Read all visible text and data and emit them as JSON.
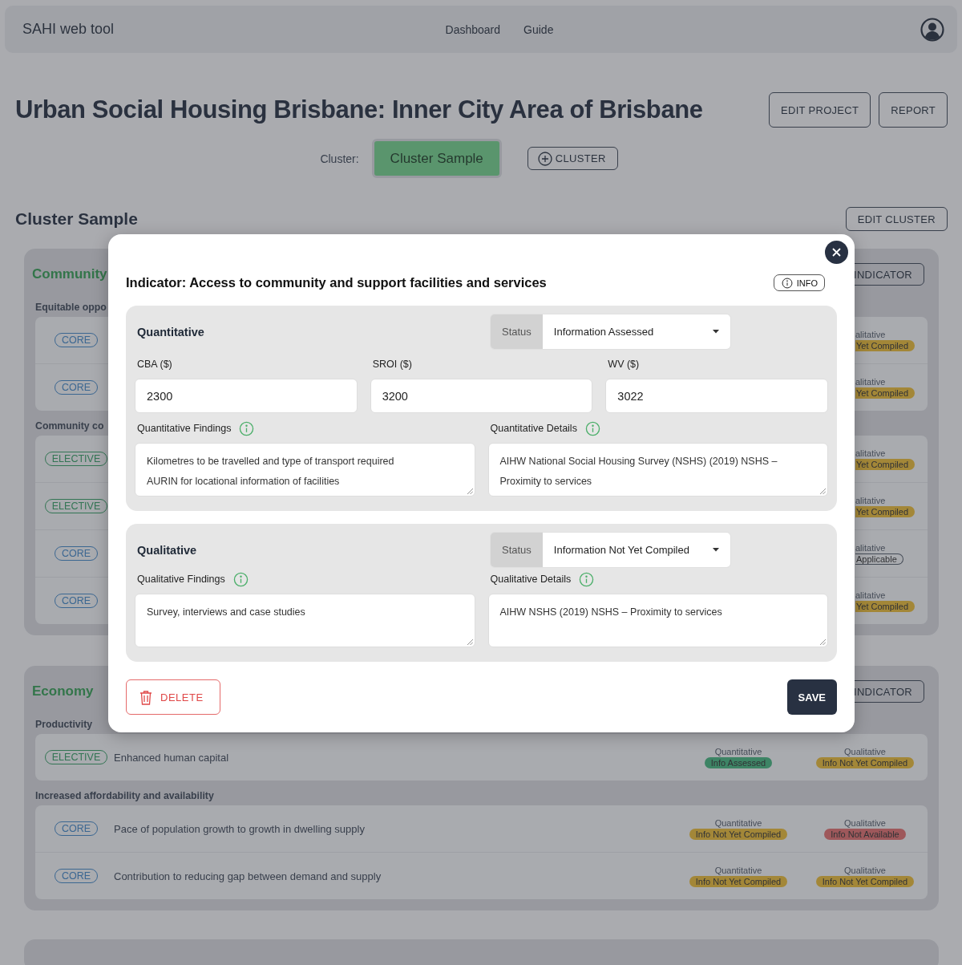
{
  "header": {
    "brand": "SAHI web tool",
    "nav": [
      "Dashboard",
      "Guide"
    ]
  },
  "project": {
    "title": "Urban Social Housing Brisbane: Inner City Area of Brisbane",
    "actions": [
      "EDIT PROJECT",
      "REPORT"
    ]
  },
  "cluster_bar": {
    "label": "Cluster:",
    "clusters": [
      {
        "label": "Cluster Sample",
        "selected": true
      }
    ],
    "add_button": "CLUSTER"
  },
  "cluster": {
    "title": "Cluster Sample",
    "edit_button": "EDIT CLUSTER"
  },
  "sections": [
    {
      "title": "Community",
      "add_button": "INDICATOR",
      "groups": [
        {
          "title": "Equitable oppo",
          "rows": [
            {
              "tag": "CORE",
              "kind": "core",
              "statuses": [
                {
                  "label": "alitative",
                  "badge": "Yet Compiled",
                  "kind": "not_yet"
                }
              ]
            },
            {
              "tag": "CORE",
              "kind": "core",
              "statuses": [
                {
                  "label": "alitative",
                  "badge": "Yet Compiled",
                  "kind": "not_yet"
                }
              ]
            }
          ]
        },
        {
          "title": "Community co",
          "rows": [
            {
              "tag": "ELECTIVE",
              "kind": "elective",
              "statuses": [
                {
                  "label": "alitative",
                  "badge": "Yet Compiled",
                  "kind": "not_yet"
                }
              ]
            },
            {
              "tag": "ELECTIVE",
              "kind": "elective",
              "statuses": [
                {
                  "label": "alitative",
                  "badge": "Yet Compiled",
                  "kind": "not_yet"
                }
              ]
            },
            {
              "tag": "CORE",
              "kind": "core",
              "statuses": [
                {
                  "label": "alitative",
                  "badge": "Applicable",
                  "kind": "not_applicable"
                }
              ]
            },
            {
              "tag": "CORE",
              "kind": "core",
              "statuses": [
                {
                  "label": "alitative",
                  "badge": "Yet Compiled",
                  "kind": "not_yet"
                }
              ]
            }
          ]
        }
      ]
    },
    {
      "title": "Economy",
      "add_button": "INDICATOR",
      "groups": [
        {
          "title": "Productivity",
          "rows": [
            {
              "tag": "ELECTIVE",
              "kind": "elective",
              "name": "Enhanced human capital",
              "statuses": [
                {
                  "label": "Quantitative",
                  "badge": "Info Assessed",
                  "kind": "assessed"
                },
                {
                  "label": "Qualitative",
                  "badge": "Info Not Yet Compiled",
                  "kind": "not_yet"
                }
              ]
            }
          ]
        },
        {
          "title": "Increased affordability and availability",
          "rows": [
            {
              "tag": "CORE",
              "kind": "core",
              "name": "Pace of population growth to growth in dwelling supply",
              "statuses": [
                {
                  "label": "Quantitative",
                  "badge": "Info Not Yet Compiled",
                  "kind": "not_yet"
                },
                {
                  "label": "Qualitative",
                  "badge": "Info Not Available",
                  "kind": "not_available"
                }
              ]
            },
            {
              "tag": "CORE",
              "kind": "core",
              "name": "Contribution to reducing gap between demand and supply",
              "statuses": [
                {
                  "label": "Quantitative",
                  "badge": "Info Not Yet Compiled",
                  "kind": "not_yet"
                },
                {
                  "label": "Qualitative",
                  "badge": "Info Not Yet Compiled",
                  "kind": "not_yet"
                }
              ]
            }
          ]
        }
      ]
    }
  ],
  "modal": {
    "title": "Indicator: Access to community and support facilities and services",
    "info_button": "INFO",
    "panels": [
      {
        "title": "Quantitative",
        "status_label": "Status",
        "status_value": "Information Assessed",
        "inputs": [
          {
            "label": "CBA ($)",
            "value": "2300"
          },
          {
            "label": "SROI ($)",
            "value": "3200"
          },
          {
            "label": "WV ($)",
            "value": "3022"
          }
        ],
        "notes": [
          {
            "label": "Quantitative Findings",
            "text": "Kilometres to be travelled and type of transport required\nAURIN for locational information of facilities"
          },
          {
            "label": "Quantitative Details",
            "text": "AIHW National Social Housing Survey (NSHS) (2019) NSHS –\nProximity to services"
          }
        ]
      },
      {
        "title": "Qualitative",
        "status_label": "Status",
        "status_value": "Information Not Yet Compiled",
        "notes": [
          {
            "label": "Qualitative Findings",
            "text": "Survey, interviews and case studies"
          },
          {
            "label": "Qualitative Details",
            "text": "AIHW NSHS (2019) NSHS – Proximity to services"
          }
        ]
      }
    ],
    "delete_button": "DELETE",
    "save_button": "SAVE"
  }
}
